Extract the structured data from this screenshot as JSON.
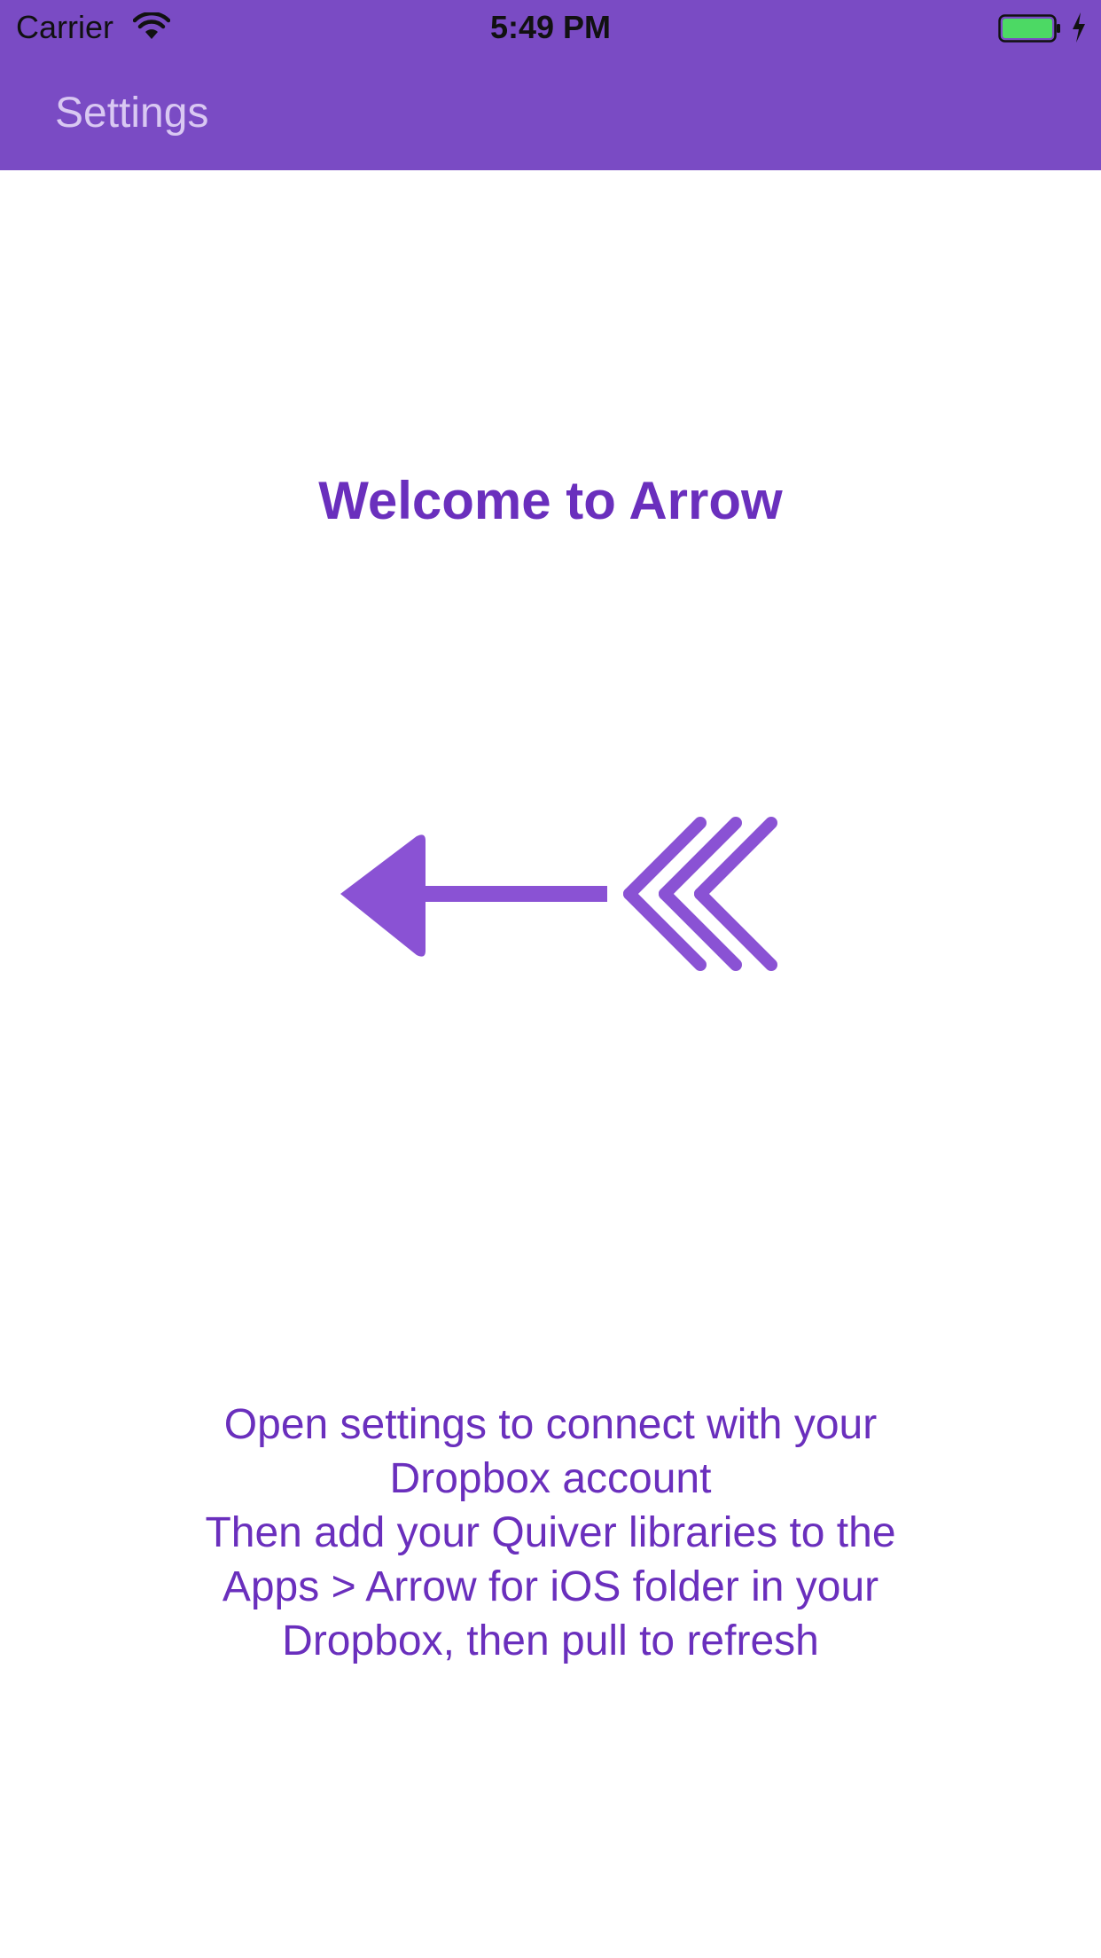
{
  "status_bar": {
    "carrier": "Carrier",
    "time": "5:49 PM",
    "wifi_icon": "wifi-icon",
    "battery_icon": "battery-charging-icon",
    "battery_color": "#4cd964"
  },
  "nav": {
    "settings_label": "Settings",
    "background_color": "#7a4bc4"
  },
  "main": {
    "title": "Welcome to Arrow",
    "logo_icon": "arrow-logo-icon",
    "accent_color": "#6a2fbd",
    "instructions": [
      "Open settings to connect with your",
      "Dropbox account",
      "Then add your Quiver libraries to the",
      "Apps > Arrow for iOS folder in your",
      "Dropbox, then pull to refresh"
    ]
  }
}
